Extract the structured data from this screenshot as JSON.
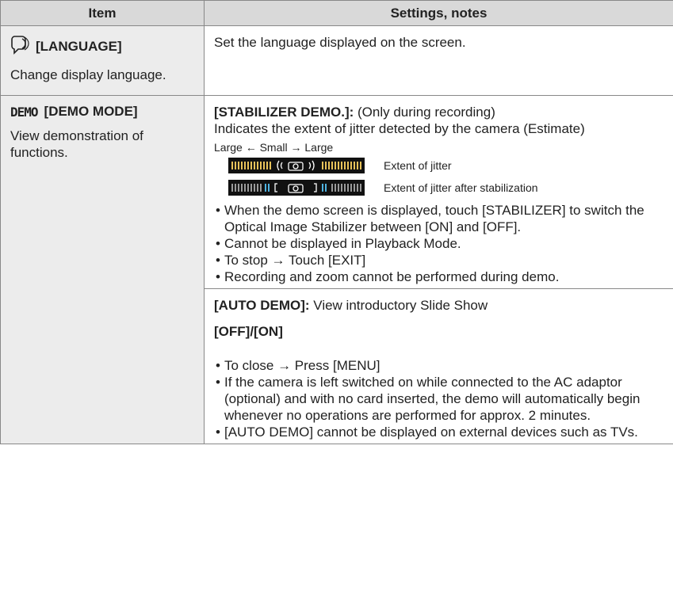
{
  "header": {
    "col1": "Item",
    "col2": "Settings, notes"
  },
  "language": {
    "icon": "language-icon",
    "title": "[LANGUAGE]",
    "desc": "Change display language.",
    "setting": "Set the language displayed on the screen."
  },
  "demo": {
    "icon_label": "DEMO",
    "title": "[DEMO MODE]",
    "desc": "View demonstration of functions.",
    "stabilizer": {
      "label": "[STABILIZER DEMO.]:",
      "label_note": " (Only during recording)",
      "line2": "Indicates the extent of jitter detected by the camera (Estimate)",
      "scale": "Large ← Small → Large",
      "meter1_label": "Extent of jitter",
      "meter2_label": "Extent of jitter after stabilization",
      "notes": [
        "When the demo screen is displayed, touch [STABILIZER] to switch the Optical Image Stabilizer between [ON] and [OFF].",
        "Cannot be displayed in Playback Mode.",
        "To stop → Touch [EXIT]",
        "Recording and zoom cannot be performed during demo."
      ]
    },
    "auto": {
      "label": "[AUTO DEMO]:",
      "label_note": " View introductory Slide Show",
      "options": "[OFF]/[ON]",
      "notes": [
        "To close → Press [MENU]",
        "If the camera is left switched on while connected to the AC adaptor (optional) and with no card inserted, the demo will automatically begin whenever no operations are performed for approx. 2 minutes.",
        "[AUTO DEMO] cannot be displayed on external devices such as TVs."
      ]
    }
  },
  "colors": {
    "header_bg": "#d9d9d9",
    "left_bg": "#ececec",
    "border": "#888888"
  }
}
